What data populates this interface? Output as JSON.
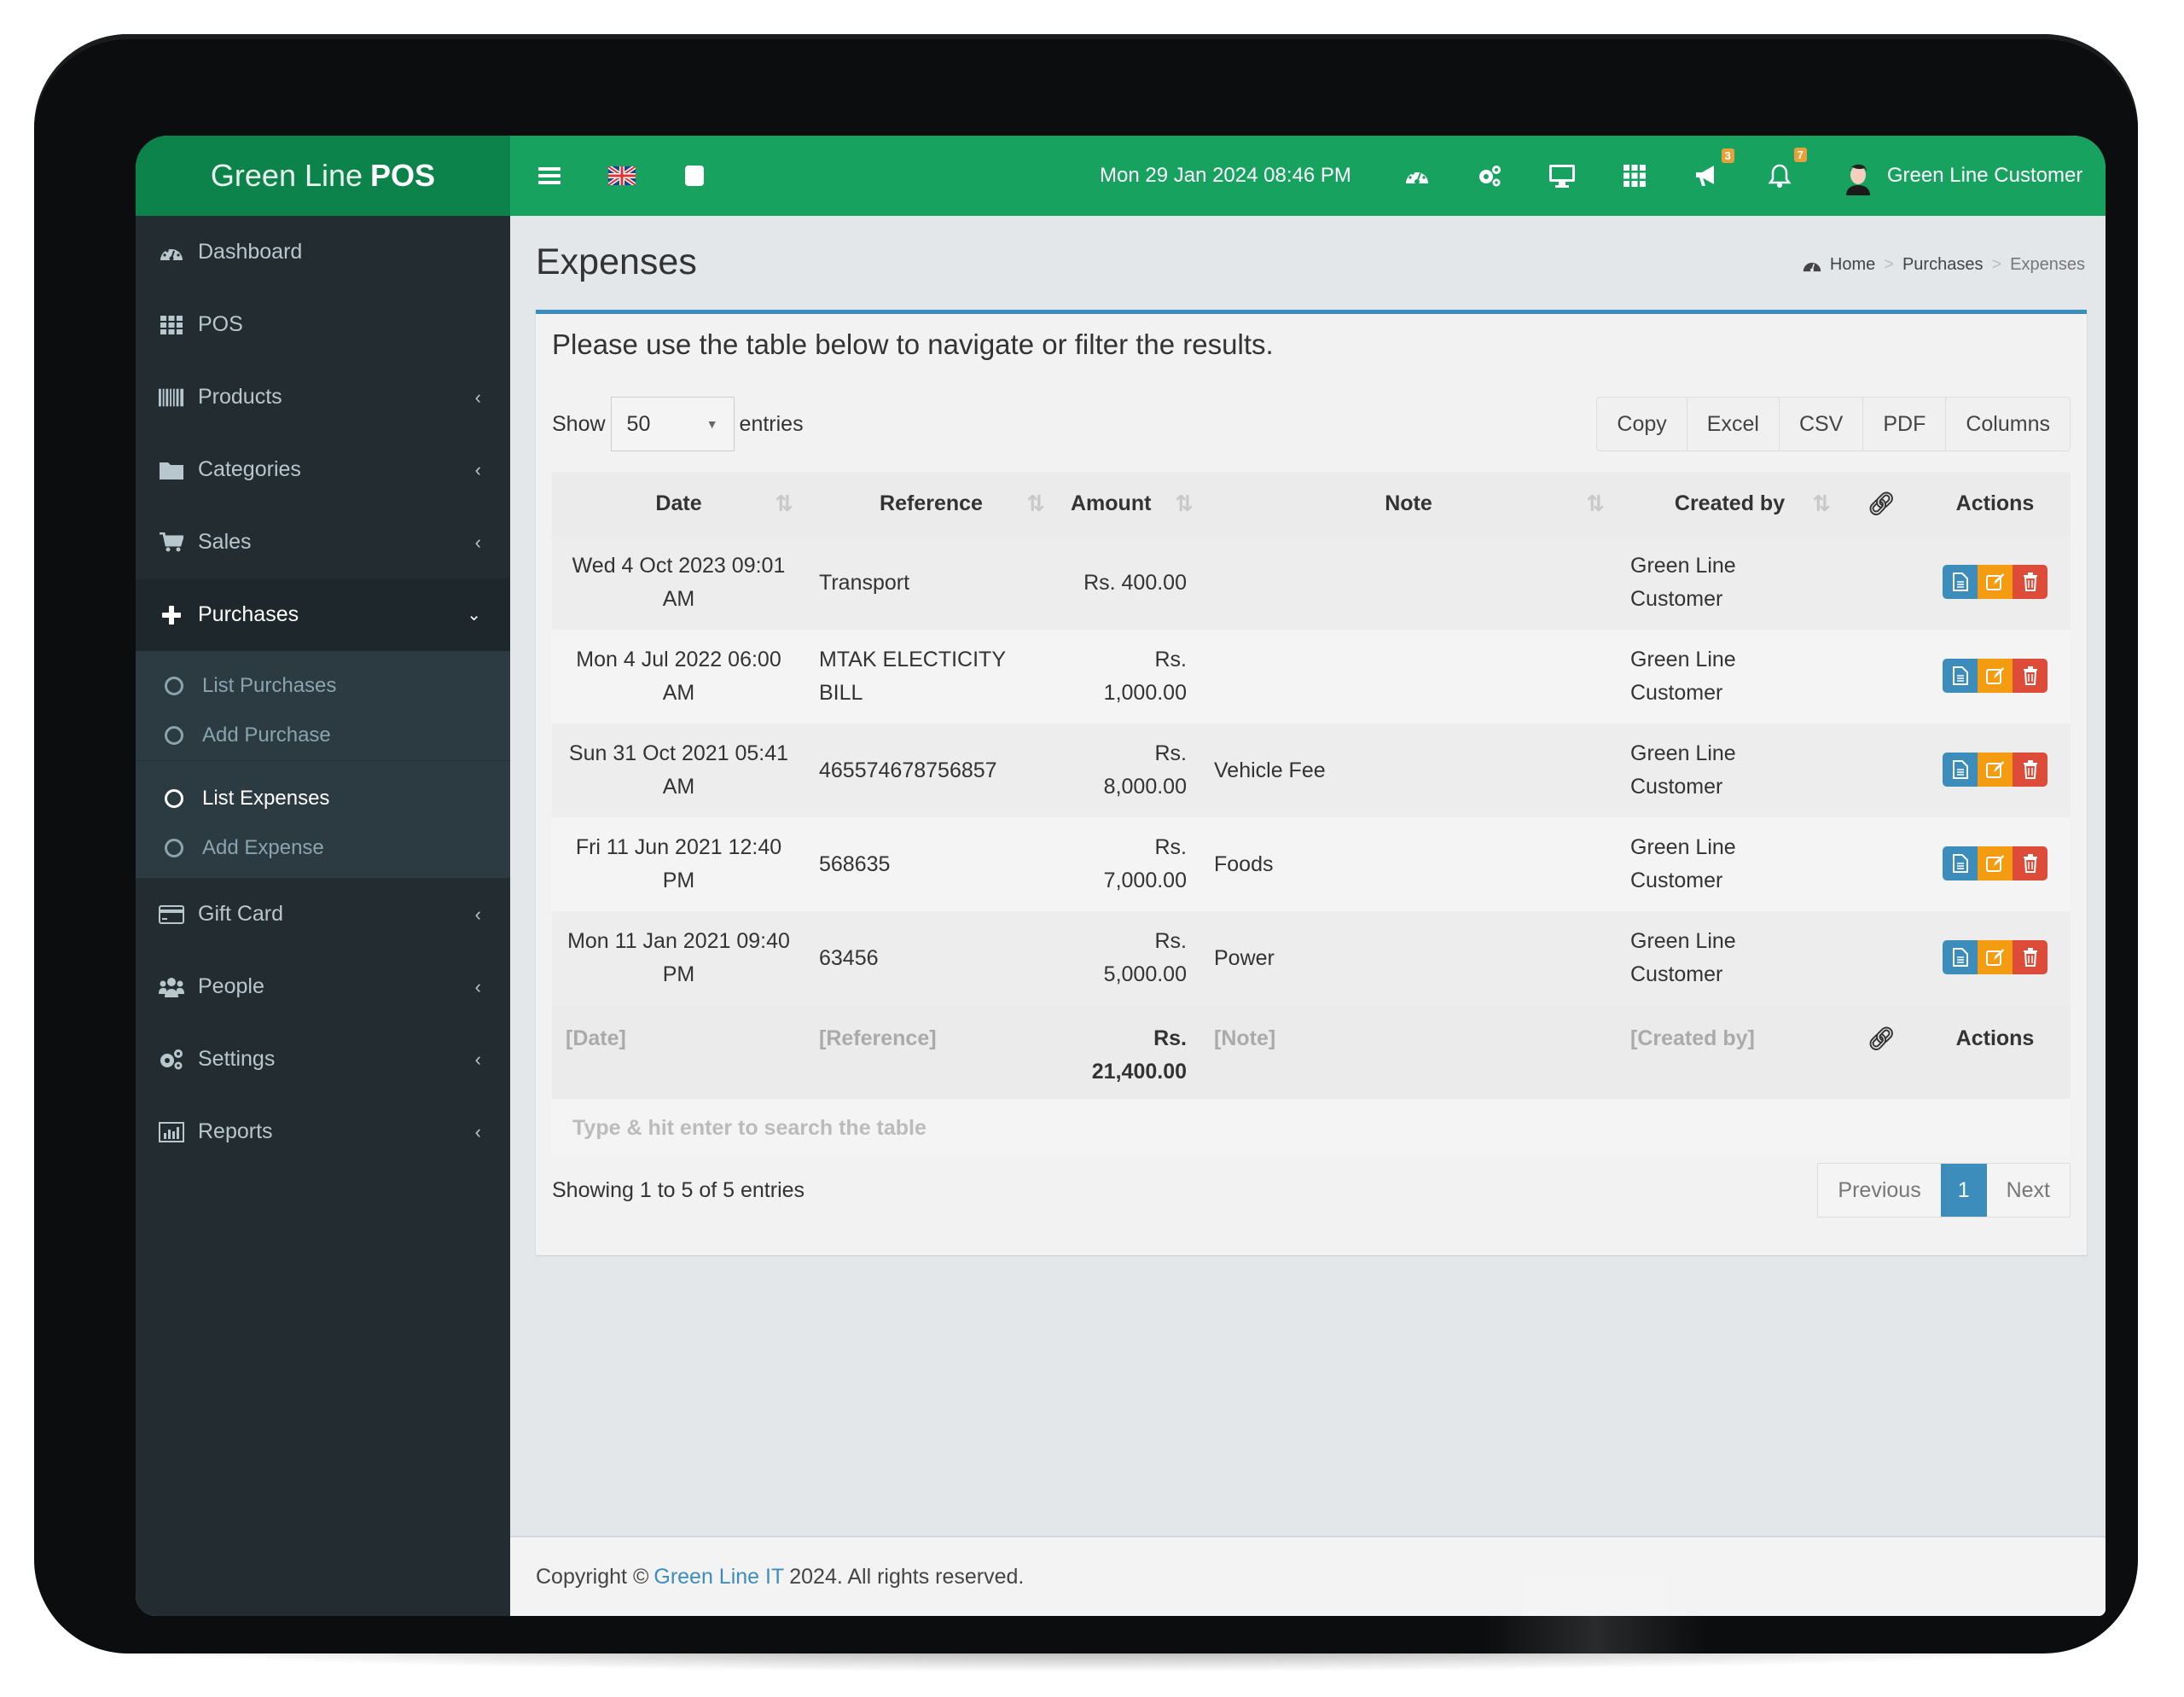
{
  "header": {
    "brand_prefix": "Green Line",
    "brand_bold": "POS",
    "datetime": "Mon 29 Jan 2024 08:46 PM",
    "notifications_badge": "3",
    "alerts_badge": "7",
    "user_name": "Green Line Customer",
    "colors": {
      "brand": "#0b834a",
      "bar": "#17a35f",
      "badge": "#e8a13a"
    }
  },
  "sidebar": {
    "items": [
      {
        "label": "Dashboard",
        "icon": "dashboard-icon"
      },
      {
        "label": "POS",
        "icon": "grid-icon"
      },
      {
        "label": "Products",
        "icon": "barcode-icon"
      },
      {
        "label": "Categories",
        "icon": "folder-icon"
      },
      {
        "label": "Sales",
        "icon": "cart-icon"
      },
      {
        "label": "Purchases",
        "icon": "plus-icon"
      },
      {
        "label": "Gift Card",
        "icon": "credit-card-icon"
      },
      {
        "label": "People",
        "icon": "users-icon"
      },
      {
        "label": "Settings",
        "icon": "gears-icon"
      },
      {
        "label": "Reports",
        "icon": "bar-chart-icon"
      }
    ],
    "purchases_sub": [
      {
        "label": "List Purchases"
      },
      {
        "label": "Add Purchase"
      },
      {
        "label": "List Expenses"
      },
      {
        "label": "Add Expense"
      }
    ]
  },
  "page": {
    "title": "Expenses",
    "breadcrumb": [
      "Home",
      "Purchases",
      "Expenses"
    ],
    "intro": "Please use the table below to navigate or filter the results.",
    "show_label": "Show",
    "entries_label": "entries",
    "page_size": "50",
    "export_buttons": [
      "Copy",
      "Excel",
      "CSV",
      "PDF",
      "Columns"
    ]
  },
  "table": {
    "headers": [
      "Date",
      "Reference",
      "Amount",
      "Note",
      "Created by",
      "",
      "Actions"
    ],
    "rows": [
      {
        "date": "Wed 4 Oct 2023 09:01 AM",
        "reference": "Transport",
        "amount": "Rs. 400.00",
        "note": "",
        "created_by": "Green Line Customer"
      },
      {
        "date": "Mon 4 Jul 2022 06:00 AM",
        "reference": "MTAK ELECTICITY BILL",
        "amount": "Rs. 1,000.00",
        "note": "",
        "created_by": "Green Line Customer"
      },
      {
        "date": "Sun 31 Oct 2021 05:41 AM",
        "reference": "465574678756857",
        "amount": "Rs. 8,000.00",
        "note": "Vehicle Fee",
        "created_by": "Green Line Customer"
      },
      {
        "date": "Fri 11 Jun 2021 12:40 PM",
        "reference": "568635",
        "amount": "Rs. 7,000.00",
        "note": "Foods",
        "created_by": "Green Line Customer"
      },
      {
        "date": "Mon 11 Jan 2021 09:40 PM",
        "reference": "63456",
        "amount": "Rs. 5,000.00",
        "note": "Power",
        "created_by": "Green Line Customer"
      }
    ],
    "footer": {
      "date": "[Date]",
      "reference": "[Reference]",
      "amount": "Rs. 21,400.00",
      "note": "[Note]",
      "created_by": "[Created by]",
      "actions": "Actions"
    },
    "search_placeholder": "Type & hit enter to search the table",
    "action_colors": {
      "view": "#3c8dbc",
      "edit": "#f39c12",
      "delete": "#dd4b39"
    }
  },
  "pagination": {
    "info": "Showing 1 to 5 of 5 entries",
    "previous": "Previous",
    "current": "1",
    "next": "Next"
  },
  "footer": {
    "prefix": "Copyright ©",
    "link": "Green Line IT",
    "suffix": "2024. All rights reserved."
  }
}
